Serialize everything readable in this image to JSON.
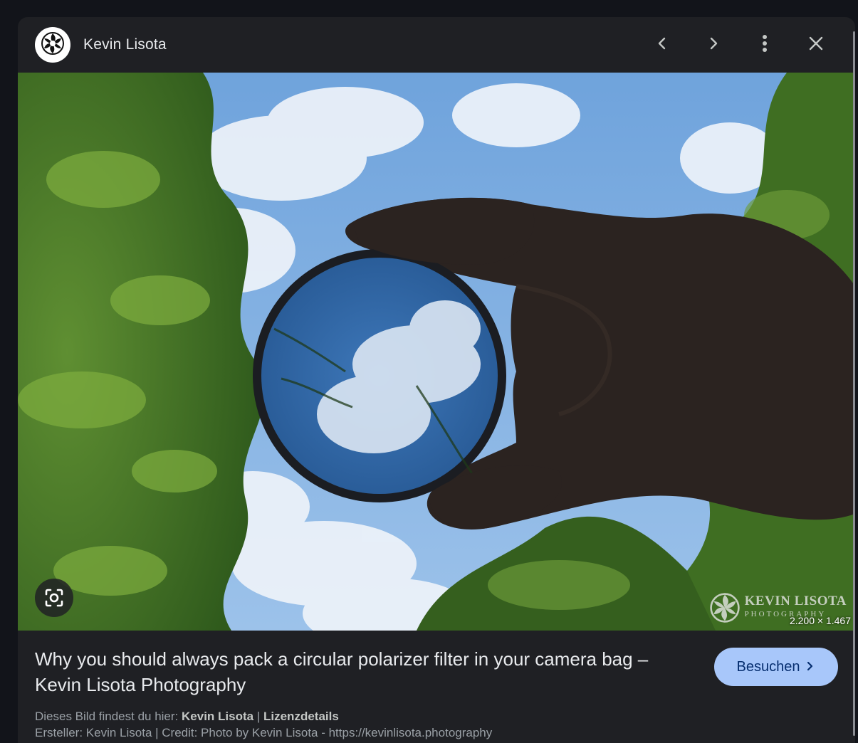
{
  "header": {
    "site_name": "Kevin Lisota",
    "icons": [
      "aperture-logo-icon",
      "chevron-left-icon",
      "chevron-right-icon",
      "more-vert-icon",
      "close-icon"
    ]
  },
  "image": {
    "dimensions": "2.200 × 1.467",
    "watermark_line1": "KEVIN LISOTA",
    "watermark_line2": "PHOTOGRAPHY"
  },
  "result": {
    "title": "Why you should always pack a circular polarizer filter in your camera bag – Kevin Lisota Photography",
    "visit_label": "Besuchen",
    "source_prefix": "Dieses Bild findest du hier:",
    "source_link": "Kevin Lisota",
    "separator": "|",
    "license_link": "Lizenzdetails",
    "credit_line": "Ersteller: Kevin Lisota | Credit: Photo by Kevin Lisota - https://kevinlisota.photography"
  },
  "colors": {
    "panel_bg": "#1f2024",
    "visit_button_bg": "#a8c7fa",
    "visit_button_text": "#062e6f"
  }
}
